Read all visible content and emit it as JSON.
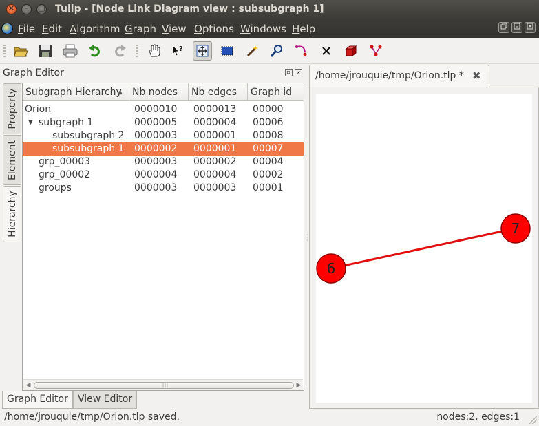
{
  "window": {
    "title": "Tulip - [Node Link Diagram view : subsubgraph 1]",
    "close_glyph": "×",
    "minimize_glyph": "–",
    "maximize_glyph": "□"
  },
  "menu": {
    "items": [
      {
        "label": "File",
        "hotkey": "F",
        "rest": "ile"
      },
      {
        "label": "Edit",
        "hotkey": "E",
        "rest": "dit"
      },
      {
        "label": "Algorithm",
        "hotkey": "A",
        "rest": "lgorithm"
      },
      {
        "label": "Graph",
        "hotkey": "G",
        "rest": "raph"
      },
      {
        "label": "View",
        "hotkey": "V",
        "rest": "iew"
      },
      {
        "label": "Options",
        "hotkey": "O",
        "rest": "ptions"
      },
      {
        "label": "Windows",
        "hotkey": "W",
        "rest": "indows"
      },
      {
        "label": "Help",
        "hotkey": "H",
        "rest": "elp"
      }
    ],
    "mdi_buttons": [
      "restore",
      "minimize",
      "close"
    ]
  },
  "toolbar": {
    "buttons": [
      "open-folder",
      "save",
      "print",
      "undo",
      "redo",
      "pan-hand",
      "what-is-this",
      "navigate-graph",
      "rectangle-selection",
      "magic-wand",
      "zoom-magnifier",
      "edit-edge-bends",
      "delete-element",
      "add-node-cube",
      "add-edge"
    ],
    "active": "navigate-graph",
    "accent_green": "#2e8b1e",
    "accent_red": "#d11a1a"
  },
  "graph_editor": {
    "title": "Graph Editor",
    "side_tabs": [
      "Property",
      "Element",
      "Hierarchy"
    ],
    "active_side_tab": "Hierarchy",
    "columns": [
      "Subgraph Hierarchy",
      "Nb nodes",
      "Nb edges",
      "Graph id"
    ],
    "rows": [
      {
        "name": "Orion",
        "depth": 0,
        "expanded": null,
        "nodes": "0000010",
        "edges": "0000013",
        "id": "00000",
        "selected": false
      },
      {
        "name": "subgraph 1",
        "depth": 1,
        "expanded": true,
        "nodes": "0000005",
        "edges": "0000004",
        "id": "00006",
        "selected": false
      },
      {
        "name": "subsubgraph 2",
        "depth": 2,
        "expanded": null,
        "nodes": "0000003",
        "edges": "0000001",
        "id": "00008",
        "selected": false
      },
      {
        "name": "subsubgraph 1",
        "depth": 2,
        "expanded": null,
        "nodes": "0000002",
        "edges": "0000001",
        "id": "00007",
        "selected": true
      },
      {
        "name": "grp_00003",
        "depth": 1,
        "expanded": null,
        "nodes": "0000003",
        "edges": "0000002",
        "id": "00004",
        "selected": false
      },
      {
        "name": "grp_00002",
        "depth": 1,
        "expanded": null,
        "nodes": "0000004",
        "edges": "0000004",
        "id": "00002",
        "selected": false
      },
      {
        "name": "groups",
        "depth": 1,
        "expanded": null,
        "nodes": "0000003",
        "edges": "0000003",
        "id": "00001",
        "selected": false
      }
    ],
    "bottom_tabs": [
      "Graph Editor",
      "View Editor"
    ],
    "active_bottom_tab": "Graph Editor",
    "selection_color": "#f07746"
  },
  "document": {
    "tab_label": "/home/jrouquie/tmp/Orion.tlp *",
    "close_glyph": "✖"
  },
  "graph_view": {
    "nodes": [
      {
        "label": "6"
      },
      {
        "label": "7"
      }
    ],
    "edge_color": "#e01010",
    "node_color": "#ff0000"
  },
  "status": {
    "message": "/home/jrouquie/tmp/Orion.tlp saved.",
    "counts": "nodes:2, edges:1"
  }
}
